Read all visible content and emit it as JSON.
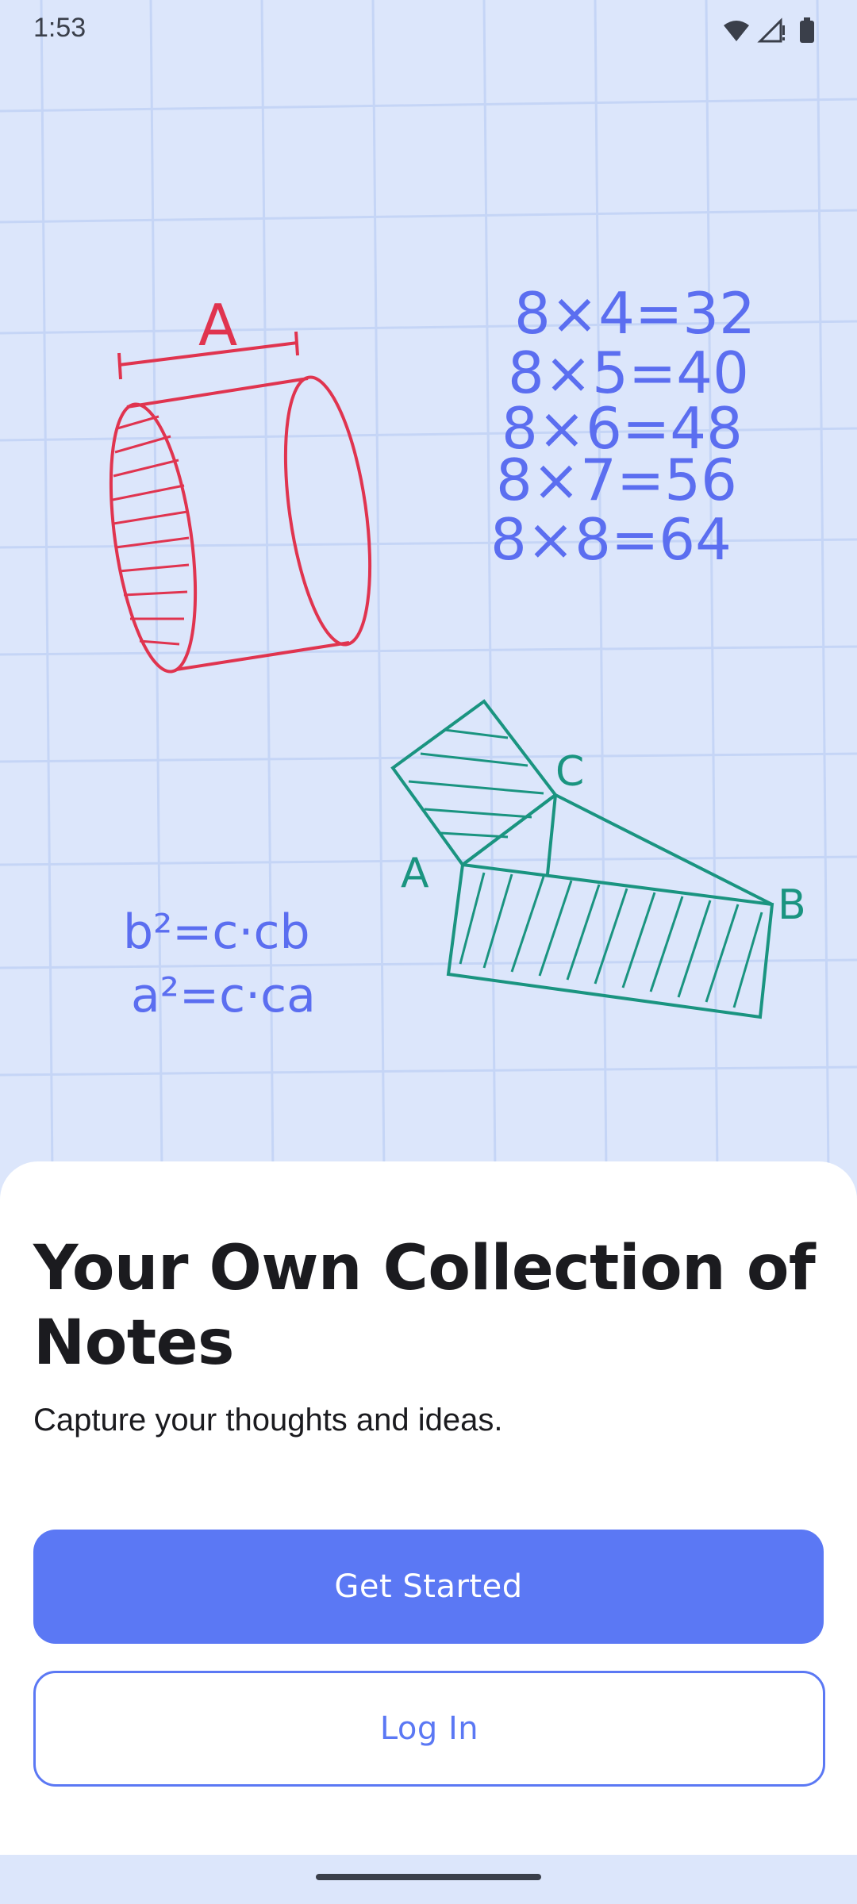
{
  "status_bar": {
    "time": "1:53",
    "icons": [
      "wifi-icon",
      "cellular-signal-icon",
      "battery-icon"
    ]
  },
  "illustration": {
    "cylinder_label": "A",
    "multiplication": [
      "8×4=32",
      "8×5=40",
      "8×6=48",
      "8×7=56",
      "8×8=64"
    ],
    "formulas": [
      "b²=c·cb",
      "a²=c·ca"
    ],
    "triangle_labels": {
      "a": "A",
      "b": "B",
      "c": "C"
    }
  },
  "onboarding": {
    "title": "Your Own Collection of Notes",
    "subtitle": "Capture your thoughts and ideas.",
    "get_started_label": "Get Started",
    "login_label": "Log In"
  },
  "colors": {
    "background": "#dce6fb",
    "accent": "#5b78f4",
    "cylinder": "#e0344f",
    "math_text": "#5b6ef0",
    "geometry": "#1a9480"
  }
}
